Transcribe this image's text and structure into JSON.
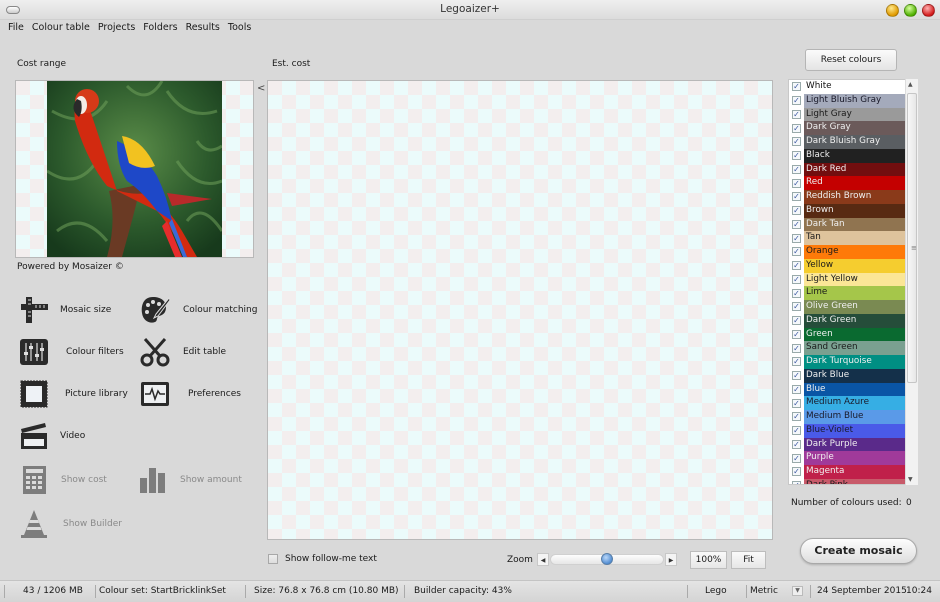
{
  "window": {
    "title": "Legoaizer+"
  },
  "menu": [
    "File",
    "Colour table",
    "Projects",
    "Folders",
    "Results",
    "Tools"
  ],
  "left": {
    "cost_range_label": "Cost range",
    "powered_by": "Powered by Mosaizer ©",
    "tools": [
      {
        "label": "Mosaic size",
        "icon": "ruler-icon",
        "enabled": true
      },
      {
        "label": "Colour matching",
        "icon": "palette-icon",
        "enabled": true
      },
      {
        "label": "Colour filters",
        "icon": "sliders-icon",
        "enabled": true
      },
      {
        "label": "Edit table",
        "icon": "scissors-icon",
        "enabled": true
      },
      {
        "label": "Picture library",
        "icon": "picture-frame-icon",
        "enabled": true
      },
      {
        "label": "Preferences",
        "icon": "monitor-pulse-icon",
        "enabled": true
      },
      {
        "label": "Video",
        "icon": "clapperboard-icon",
        "enabled": true
      },
      {
        "label": "Show cost",
        "icon": "calculator-icon",
        "enabled": false
      },
      {
        "label": "Show amount",
        "icon": "bar-chart-icon",
        "enabled": false
      },
      {
        "label": "Show Builder",
        "icon": "traffic-cone-icon",
        "enabled": false
      }
    ]
  },
  "center": {
    "est_cost_label": "Est. cost",
    "collapse_glyph": "<",
    "follow_me_label": "Show follow-me text",
    "follow_me_checked": false,
    "zoom_label": "Zoom",
    "zoom_slider_fraction": 0.5,
    "zoom_100_label": "100%",
    "fit_label": "Fit"
  },
  "right": {
    "reset_label": "Reset colours",
    "colours": [
      {
        "name": "White",
        "color": "#ffffff",
        "text": "#111111",
        "checked": true
      },
      {
        "name": "Light Bluish Gray",
        "color": "#a4aabb",
        "text": "#1a1a2a",
        "checked": true
      },
      {
        "name": "Light Gray",
        "color": "#9a9a9a",
        "text": "#1a1a1a",
        "checked": true
      },
      {
        "name": "Dark Gray",
        "color": "#6b5a5a",
        "text": "#f0f0f0",
        "checked": true
      },
      {
        "name": "Dark Bluish Gray",
        "color": "#5a5e62",
        "text": "#f0f0f0",
        "checked": true
      },
      {
        "name": "Black",
        "color": "#212121",
        "text": "#f0f0f0",
        "checked": true
      },
      {
        "name": "Dark Red",
        "color": "#720e0f",
        "text": "#f0f0f0",
        "checked": true
      },
      {
        "name": "Red",
        "color": "#c40000",
        "text": "#f0f0f0",
        "checked": true
      },
      {
        "name": "Reddish Brown",
        "color": "#8a3a1a",
        "text": "#f0f0f0",
        "checked": true
      },
      {
        "name": "Brown",
        "color": "#582a12",
        "text": "#f0f0f0",
        "checked": true
      },
      {
        "name": "Dark Tan",
        "color": "#907450",
        "text": "#f0f0f0",
        "checked": true
      },
      {
        "name": "Tan",
        "color": "#dec39c",
        "text": "#1a1a1a",
        "checked": true
      },
      {
        "name": "Orange",
        "color": "#fe7a09",
        "text": "#1a1a1a",
        "checked": true
      },
      {
        "name": "Yellow",
        "color": "#f5cd2f",
        "text": "#1a1a1a",
        "checked": true
      },
      {
        "name": "Light Yellow",
        "color": "#fbe696",
        "text": "#1a1a1a",
        "checked": true
      },
      {
        "name": "Lime",
        "color": "#a5c64a",
        "text": "#1a1a1a",
        "checked": true
      },
      {
        "name": "Olive Green",
        "color": "#7a8a52",
        "text": "#f0f0f0",
        "checked": true
      },
      {
        "name": "Dark Green",
        "color": "#254d3a",
        "text": "#f0f0f0",
        "checked": true
      },
      {
        "name": "Green",
        "color": "#0a6a30",
        "text": "#f0f0f0",
        "checked": true
      },
      {
        "name": "Sand Green",
        "color": "#7aa090",
        "text": "#1a1a1a",
        "checked": true
      },
      {
        "name": "Dark Turquoise",
        "color": "#008f83",
        "text": "#f0f0f0",
        "checked": true
      },
      {
        "name": "Dark Blue",
        "color": "#14304a",
        "text": "#f0f0f0",
        "checked": true
      },
      {
        "name": "Blue",
        "color": "#0a55a5",
        "text": "#f0f0f0",
        "checked": true
      },
      {
        "name": "Medium Azure",
        "color": "#36aee4",
        "text": "#1a1a2a",
        "checked": true
      },
      {
        "name": "Medium Blue",
        "color": "#5a9ae8",
        "text": "#1a1a2a",
        "checked": true
      },
      {
        "name": "Blue-Violet",
        "color": "#4a5ae8",
        "text": "#1a1a2a",
        "checked": true
      },
      {
        "name": "Dark Purple",
        "color": "#5a2a8a",
        "text": "#f0f0f0",
        "checked": true
      },
      {
        "name": "Purple",
        "color": "#a03a9a",
        "text": "#f0f0f0",
        "checked": true
      },
      {
        "name": "Magenta",
        "color": "#c0204a",
        "text": "#f0f0f0",
        "checked": true
      },
      {
        "name": "Dark Pink",
        "color": "#c85a6a",
        "text": "#1a1a1a",
        "checked": true
      }
    ],
    "count_label": "Number of colours used:",
    "count_value": "0",
    "create_label": "Create mosaic"
  },
  "status": {
    "memory": "43 / 1206 MB",
    "colour_set": "Colour set: StartBricklinkSet",
    "size": "Size: 76.8 x 76.8 cm (10.80 MB)",
    "builder_capacity": "Builder capacity: 43%",
    "brand": "Lego",
    "units": "Metric",
    "date": "24 September 2015",
    "time": "10:24"
  }
}
